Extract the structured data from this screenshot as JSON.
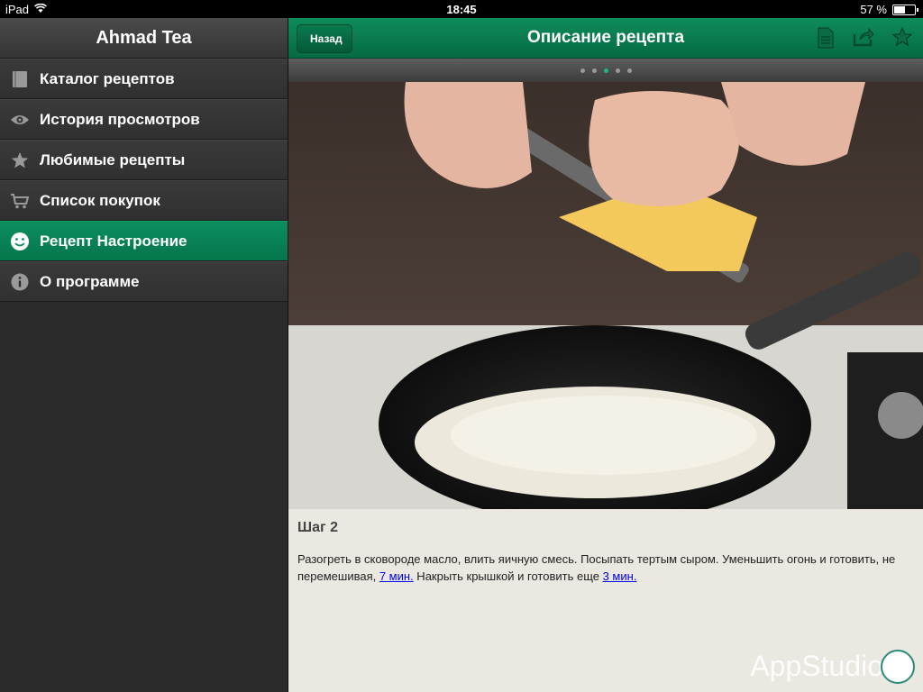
{
  "status": {
    "device": "iPad",
    "time": "18:45",
    "battery": "57 %",
    "battery_level": 0.57
  },
  "sidebar": {
    "title": "Ahmad Tea",
    "items": [
      {
        "label": "Каталог рецептов",
        "icon": "book-icon"
      },
      {
        "label": "История просмотров",
        "icon": "eye-icon"
      },
      {
        "label": "Любимые рецепты",
        "icon": "star-icon"
      },
      {
        "label": "Список покупок",
        "icon": "cart-icon"
      },
      {
        "label": "Рецепт Настроение",
        "icon": "smiley-icon",
        "active": true
      },
      {
        "label": "О программе",
        "icon": "info-icon"
      }
    ]
  },
  "nav": {
    "back": "Назад",
    "title": "Описание рецепта"
  },
  "pager": {
    "count": 5,
    "current": 3
  },
  "step": {
    "title": "Шаг 2",
    "text_1": "Разогреть в сковороде масло, влить яичную смесь. Посыпать тертым сыром. Уменьшить огонь и готовить, не перемешивая, ",
    "link_1": "7 мин.",
    "text_2": " Накрыть крышкой и готовить еще ",
    "link_2": "3 мин."
  },
  "watermark": "AppStudio",
  "colors": {
    "accent": "#0b8f5f"
  }
}
